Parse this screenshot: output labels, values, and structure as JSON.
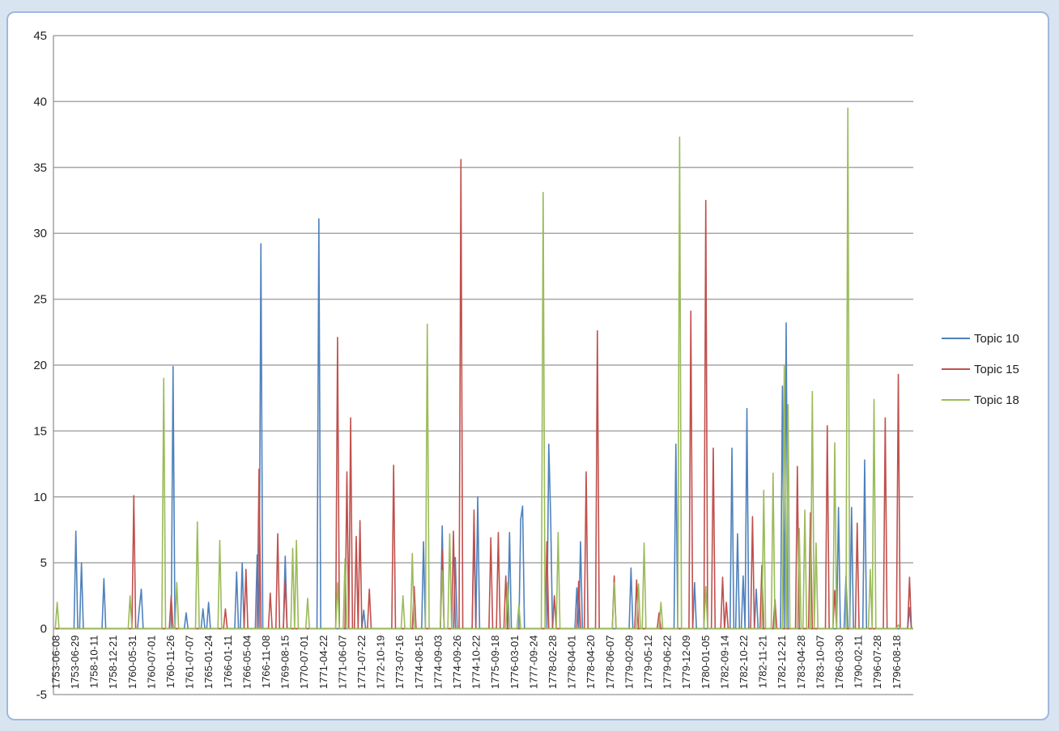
{
  "chart_data": {
    "type": "line",
    "title": "",
    "xlabel": "",
    "ylabel": "",
    "ylim": [
      -5,
      45
    ],
    "yticks": [
      -5,
      0,
      5,
      10,
      15,
      20,
      25,
      30,
      35,
      40,
      45
    ],
    "grid": "horizontal",
    "legend": "right",
    "x_tick_labels": [
      "1753-06-08",
      "1753-06-29",
      "1758-10-11",
      "1758-12-21",
      "1760-05-31",
      "1760-07-01",
      "1760-11-26",
      "1761-07-07",
      "1765-01-24",
      "1766-01-11",
      "1766-05-04",
      "1766-11-08",
      "1769-08-15",
      "1770-07-01",
      "1771-04-22",
      "1771-06-07",
      "1771-07-22",
      "1772-10-19",
      "1773-07-16",
      "1774-08-15",
      "1774-09-03",
      "1774-09-26",
      "1774-10-22",
      "1775-09-18",
      "1776-03-01",
      "1777-09-24",
      "1778-02-28",
      "1778-04-01",
      "1778-04-20",
      "1778-06-07",
      "1779-02-09",
      "1779-05-12",
      "1779-06-22",
      "1779-12-09",
      "1780-01-05",
      "1782-09-14",
      "1782-10-22",
      "1782-11-21",
      "1782-12-21",
      "1783-04-28",
      "1783-10-07",
      "1786-03-30",
      "1790-02-11",
      "1796-07-28",
      "1796-08-18"
    ],
    "series": [
      {
        "name": "Topic 10",
        "color": "#4f81bd",
        "peaks": [
          [
            12,
            7.4
          ],
          [
            15,
            5
          ],
          [
            27,
            3.8
          ],
          [
            46,
            1.6
          ],
          [
            47,
            3
          ],
          [
            64,
            19.9
          ],
          [
            71,
            1.2
          ],
          [
            80,
            1.5
          ],
          [
            83,
            2
          ],
          [
            98,
            4.3
          ],
          [
            101,
            5
          ],
          [
            109,
            5.6
          ],
          [
            111,
            29.2
          ],
          [
            124,
            5.5
          ],
          [
            142,
            31.1
          ],
          [
            166,
            1.4
          ],
          [
            198,
            6.6
          ],
          [
            208,
            7.8
          ],
          [
            215,
            5.4
          ],
          [
            225,
            7.5
          ],
          [
            227,
            10
          ],
          [
            244,
            7.3
          ],
          [
            250,
            8.3
          ],
          [
            251,
            9.3
          ],
          [
            265,
            14
          ],
          [
            266,
            8.5
          ],
          [
            280,
            3.1
          ],
          [
            282,
            6.6
          ],
          [
            309,
            4.6
          ],
          [
            333,
            14
          ],
          [
            343,
            3.5
          ],
          [
            363,
            13.7
          ],
          [
            366,
            7.2
          ],
          [
            369,
            4
          ],
          [
            371,
            16.7
          ],
          [
            376,
            3
          ],
          [
            390,
            18.4
          ],
          [
            392,
            23.2
          ],
          [
            420,
            9.2
          ],
          [
            424,
            4
          ],
          [
            427,
            9.2
          ],
          [
            434,
            12.8
          ],
          [
            458,
            1.6
          ]
        ]
      },
      {
        "name": "Topic 15",
        "color": "#c0504d",
        "peaks": [
          [
            43,
            10.1
          ],
          [
            63,
            2.5
          ],
          [
            92,
            1.5
          ],
          [
            103,
            4.5
          ],
          [
            110,
            12.1
          ],
          [
            116,
            2.7
          ],
          [
            120,
            7.2
          ],
          [
            124,
            3.7
          ],
          [
            152,
            22.1
          ],
          [
            157,
            11.9
          ],
          [
            159,
            16
          ],
          [
            162,
            7
          ],
          [
            164,
            8.2
          ],
          [
            169,
            3
          ],
          [
            182,
            12.4
          ],
          [
            193,
            3.2
          ],
          [
            208,
            6
          ],
          [
            214,
            7.4
          ],
          [
            218,
            35.6
          ],
          [
            225,
            9
          ],
          [
            234,
            6.9
          ],
          [
            238,
            7.3
          ],
          [
            242,
            4
          ],
          [
            264,
            6.6
          ],
          [
            268,
            2.5
          ],
          [
            281,
            3.6
          ],
          [
            285,
            11.9
          ],
          [
            291,
            22.6
          ],
          [
            300,
            4
          ],
          [
            312,
            3.7
          ],
          [
            324,
            1.2
          ],
          [
            341,
            24.1
          ],
          [
            349,
            32.5
          ],
          [
            353,
            13.7
          ],
          [
            358,
            3.9
          ],
          [
            360,
            2
          ],
          [
            374,
            8.5
          ],
          [
            379,
            4.8
          ],
          [
            386,
            2.2
          ],
          [
            398,
            12.3
          ],
          [
            405,
            8.8
          ],
          [
            414,
            15.4
          ],
          [
            418,
            2.9
          ],
          [
            430,
            8
          ],
          [
            445,
            16
          ],
          [
            452,
            19.3
          ],
          [
            458,
            3.9
          ]
        ]
      },
      {
        "name": "Topic 18",
        "color": "#9bbb59",
        "peaks": [
          [
            2,
            2
          ],
          [
            41,
            2.5
          ],
          [
            59,
            19
          ],
          [
            66,
            3.5
          ],
          [
            77,
            8.1
          ],
          [
            89,
            6.7
          ],
          [
            128,
            6.1
          ],
          [
            130,
            6.7
          ],
          [
            136,
            2.3
          ],
          [
            152,
            3.5
          ],
          [
            156,
            5.3
          ],
          [
            187,
            2.5
          ],
          [
            192,
            5.7
          ],
          [
            200,
            23.1
          ],
          [
            208,
            4.4
          ],
          [
            212,
            7.2
          ],
          [
            243,
            3.5
          ],
          [
            249,
            1.8
          ],
          [
            262,
            33.1
          ],
          [
            270,
            7.3
          ],
          [
            300,
            3.5
          ],
          [
            313,
            3.4
          ],
          [
            316,
            6.5
          ],
          [
            325,
            2
          ],
          [
            335,
            37.3
          ],
          [
            349,
            3.2
          ],
          [
            380,
            10.5
          ],
          [
            385,
            11.8
          ],
          [
            391,
            20
          ],
          [
            393,
            17
          ],
          [
            399,
            7.6
          ],
          [
            402,
            9
          ],
          [
            406,
            18
          ],
          [
            408,
            6.5
          ],
          [
            418,
            14.1
          ],
          [
            425,
            39.5
          ],
          [
            437,
            4.5
          ],
          [
            439,
            17.4
          ],
          [
            452,
            0.3
          ]
        ]
      }
    ]
  }
}
